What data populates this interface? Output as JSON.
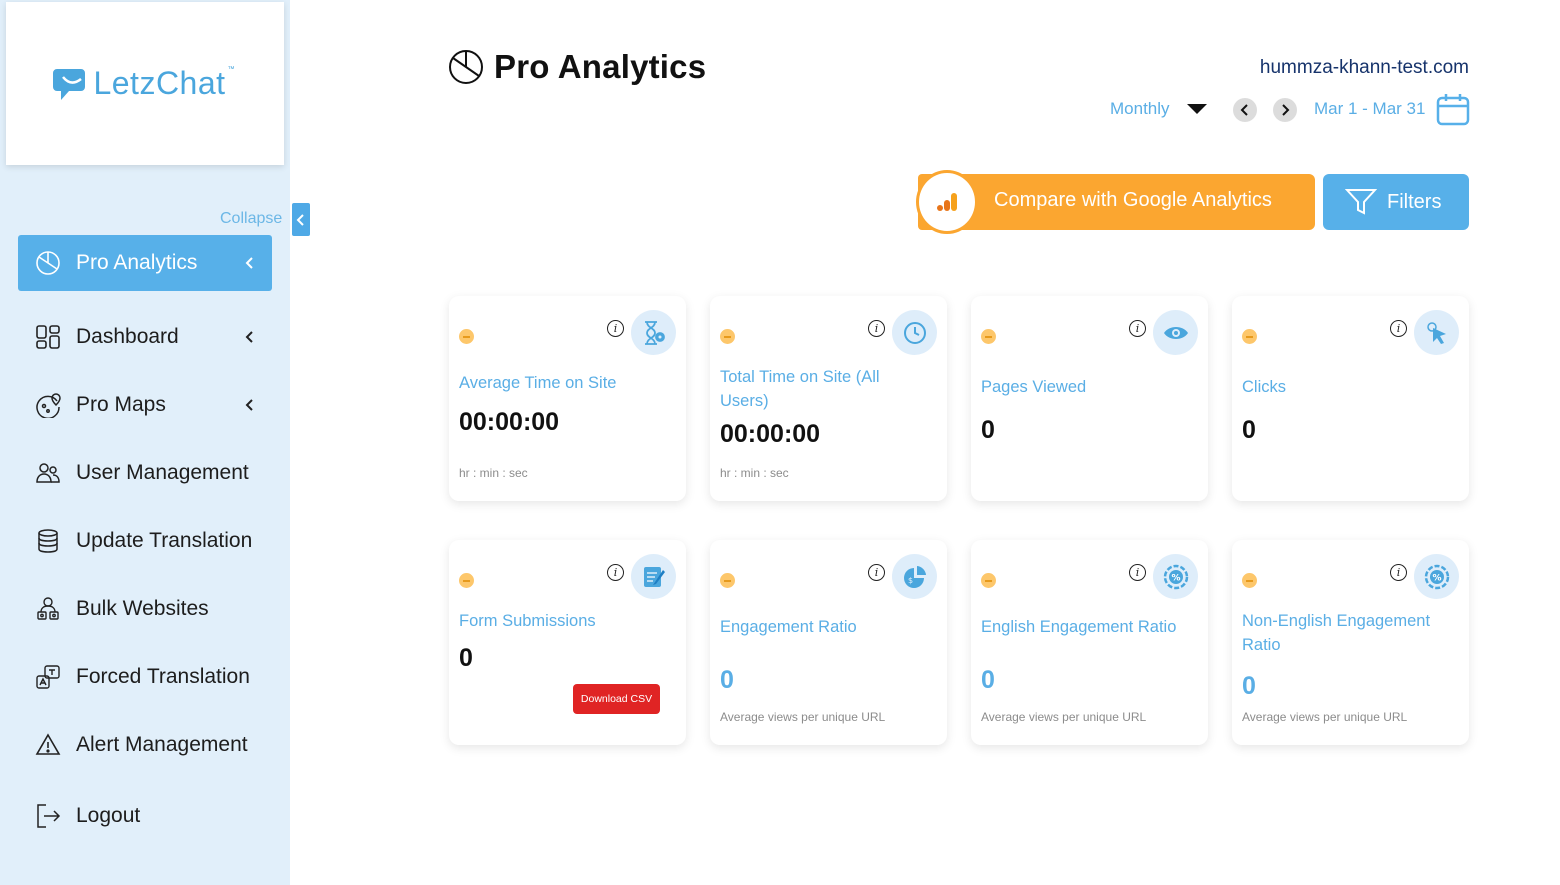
{
  "brand": {
    "name": "LetzChat",
    "tm": "™"
  },
  "sidebar": {
    "collapse_label": "Collapse",
    "items": [
      {
        "label": "Pro Analytics",
        "icon": "pie-chart-icon",
        "active": true,
        "chevron": true
      },
      {
        "label": "Dashboard",
        "icon": "dashboard-icon",
        "active": false,
        "chevron": true
      },
      {
        "label": "Pro Maps",
        "icon": "map-pin-icon",
        "active": false,
        "chevron": true
      },
      {
        "label": "User Management",
        "icon": "users-icon",
        "active": false,
        "chevron": false
      },
      {
        "label": "Update Translation",
        "icon": "database-icon",
        "active": false,
        "chevron": false
      },
      {
        "label": "Bulk Websites",
        "icon": "bulk-users-icon",
        "active": false,
        "chevron": false
      },
      {
        "label": "Forced Translation",
        "icon": "translate-icon",
        "active": false,
        "chevron": false
      },
      {
        "label": "Alert Management",
        "icon": "alert-triangle-icon",
        "active": false,
        "chevron": false
      },
      {
        "label": "Logout",
        "icon": "logout-icon",
        "active": false,
        "chevron": false
      }
    ]
  },
  "header": {
    "title": "Pro Analytics",
    "domain": "hummza-khann-test.com",
    "period": "Monthly",
    "date_range": "Mar 1 - Mar 31",
    "compare_button": "Compare with Google Analytics",
    "filters_button": "Filters"
  },
  "cards": [
    {
      "title": "Average Time on Site",
      "value": "00:00:00",
      "note": "hr : min : sec",
      "icon": "hourglass-gear-icon"
    },
    {
      "title": "Total Time on Site (All Users)",
      "value": "00:00:00",
      "note": "hr : min : sec",
      "icon": "clock-icon"
    },
    {
      "title": "Pages Viewed",
      "value": "0",
      "note": "",
      "icon": "eye-icon"
    },
    {
      "title": "Clicks",
      "value": "0",
      "note": "",
      "icon": "cursor-click-icon"
    },
    {
      "title": "Form Submissions",
      "value": "0",
      "note": "",
      "icon": "form-edit-icon",
      "button": "Download CSV"
    },
    {
      "title": "Engagement Ratio",
      "value": "0",
      "note": "Average views per unique URL",
      "icon": "pie-dollar-icon"
    },
    {
      "title": "English Engagement Ratio",
      "value": "0",
      "note": "Average views per unique URL",
      "icon": "percent-badge-icon"
    },
    {
      "title": "Non-English Engagement Ratio",
      "value": "0",
      "note": "Average views per unique URL",
      "icon": "percent-badge-icon"
    }
  ],
  "colors": {
    "accent": "#57b0e9",
    "sidebar_bg": "#e1effa",
    "orange": "#fba630",
    "danger": "#e02424",
    "label_blue": "#5aaee5"
  }
}
